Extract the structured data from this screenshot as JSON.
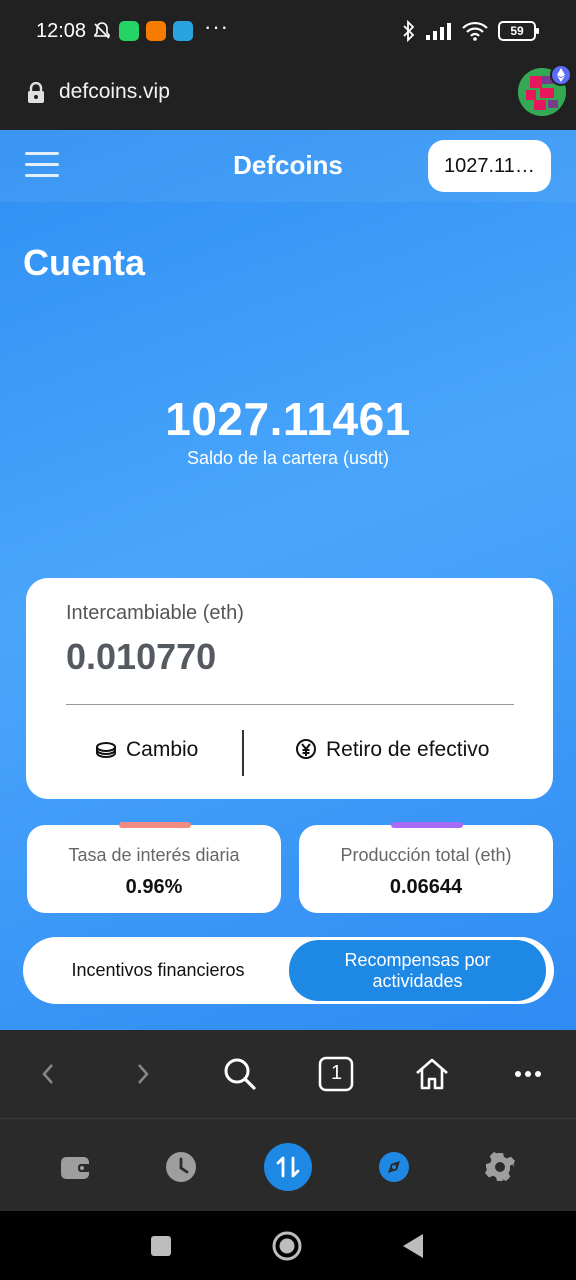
{
  "status_bar": {
    "time": "12:08",
    "battery": "59",
    "more": "···"
  },
  "browser": {
    "url": "defcoins.vip"
  },
  "header": {
    "brand": "Defcoins",
    "balance_pill": "1027.11461"
  },
  "account": {
    "title": "Cuenta",
    "balance": "1027.11461",
    "balance_label": "Saldo de la cartera (usdt)"
  },
  "exchange_card": {
    "label": "Intercambiable (eth)",
    "value": "0.010770",
    "exchange_label": "Cambio",
    "withdraw_label": "Retiro de efectivo"
  },
  "stats": [
    {
      "label": "Tasa de interés diaria",
      "value": "0.96%",
      "accent": "#f28b82"
    },
    {
      "label": "Producción total (eth)",
      "value": "0.06644",
      "accent": "#a66cf5"
    }
  ],
  "tabs": [
    {
      "label": "Incentivos financieros",
      "active": false
    },
    {
      "label": "Recompensas por actividades",
      "active": true
    }
  ],
  "browser_toolbar": {
    "tab_count": "1",
    "icons": [
      "back-icon",
      "forward-icon",
      "search-icon",
      "tabs-icon",
      "home-icon",
      "more-icon"
    ]
  },
  "wallet_toolbar": {
    "icons": [
      "wallet-icon",
      "history-icon",
      "swap-icon",
      "discover-icon",
      "settings-icon"
    ],
    "active": "swap-icon",
    "accent": "#1e88e5"
  },
  "colors": {
    "brand_blue": "#2e8ff3",
    "active_tab": "#1e88e5"
  }
}
